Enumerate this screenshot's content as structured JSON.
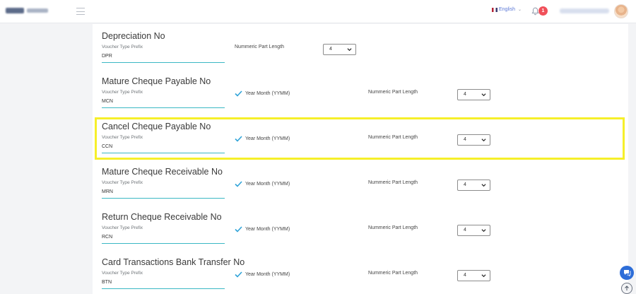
{
  "header": {
    "language": "English",
    "notification_count": "1"
  },
  "sections": [
    {
      "title": "Depreciation No",
      "prefix_label": "Voucher Type Prefix",
      "prefix_value": "DPR",
      "year_month_label": null,
      "numeric_label": "Nummeric Part Length",
      "numeric_value": "4"
    },
    {
      "title": "Mature Cheque Payable No",
      "prefix_label": "Voucher Type Prefix",
      "prefix_value": "MCN",
      "year_month_label": "Year Month (YYMM)",
      "numeric_label": "Nummeric Part Length",
      "numeric_value": "4"
    },
    {
      "title": "Cancel Cheque Payable No",
      "prefix_label": "Voucher Type Prefix",
      "prefix_value": "CCN",
      "year_month_label": "Year Month (YYMM)",
      "numeric_label": "Nummeric Part Length",
      "numeric_value": "4"
    },
    {
      "title": "Mature Cheque Receivable No",
      "prefix_label": "Voucher Type Prefix",
      "prefix_value": "MRN",
      "year_month_label": "Year Month (YYMM)",
      "numeric_label": "Nummeric Part Length",
      "numeric_value": "4"
    },
    {
      "title": "Return Cheque Receivable No",
      "prefix_label": "Voucher Type Prefix",
      "prefix_value": "RCN",
      "year_month_label": "Year Month (YYMM)",
      "numeric_label": "Nummeric Part Length",
      "numeric_value": "4"
    },
    {
      "title": "Card Transactions Bank Transfer No",
      "prefix_label": "Voucher Type Prefix",
      "prefix_value": "BTN",
      "year_month_label": "Year Month (YYMM)",
      "numeric_label": "Nummeric Part Length",
      "numeric_value": "4"
    }
  ],
  "colors": {
    "accent_underline": "#3bb8c4",
    "check": "#2fa3d8",
    "highlight": "#f6ef2a",
    "badge": "#f0505a",
    "chat_button": "#2d6dd8"
  },
  "icons": {
    "menu": "hamburger-icon",
    "bell": "bell-icon",
    "check": "check-icon",
    "select_caret": "chevron-down-icon",
    "chat": "chat-icon",
    "scroll_top": "arrow-up-icon"
  }
}
